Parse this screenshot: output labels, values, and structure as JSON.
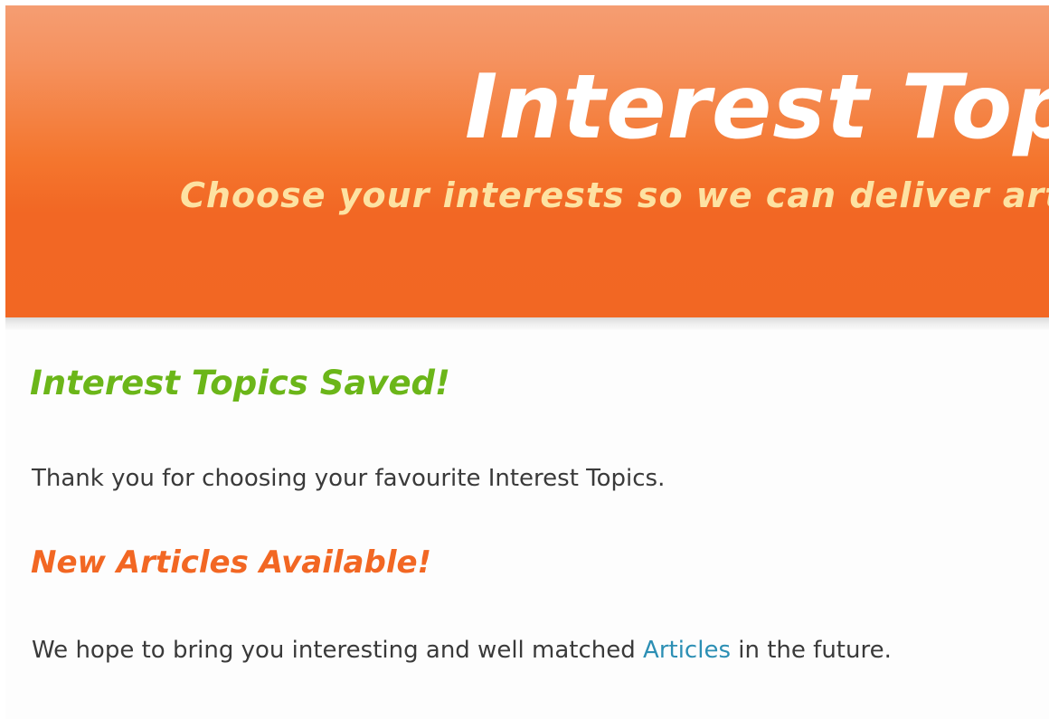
{
  "header": {
    "title": "Interest Top",
    "subtitle": "Choose your interests so we can deliver arti"
  },
  "content": {
    "saved_heading": "Interest Topics Saved!",
    "thanks_text": "Thank you for choosing your favourite Interest Topics.",
    "new_heading": "New Articles Available!",
    "hope_text_before": "We hope to bring you interesting and well matched ",
    "articles_link": "Articles",
    "hope_text_after": " in the future."
  },
  "colors": {
    "header_orange": "#f26723",
    "header_light": "#f59d72",
    "subtitle_yellow": "#fde2a2",
    "saved_green": "#6bb619",
    "new_orange": "#f26723",
    "body_text": "#3a3a3a",
    "link_blue": "#2c8fb4"
  }
}
